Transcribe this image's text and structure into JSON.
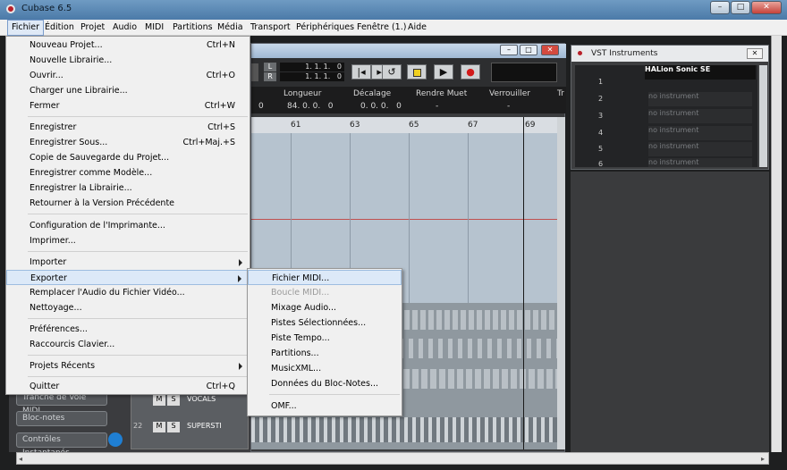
{
  "window": {
    "title": "Cubase 6.5",
    "minimize": "–",
    "maximize": "□",
    "close": "✕"
  },
  "menubar": [
    "Fichier",
    "Édition",
    "Projet",
    "Audio",
    "MIDI",
    "Partitions",
    "Média",
    "Transport",
    "Périphériques",
    "Fenêtre (1.)",
    "Aide"
  ],
  "fichier_menu": [
    {
      "label": "Nouveau Projet...",
      "shortcut": "Ctrl+N"
    },
    {
      "label": "Nouvelle Librairie...",
      "shortcut": ""
    },
    {
      "label": "Ouvrir...",
      "shortcut": "Ctrl+O"
    },
    {
      "label": "Charger une Librairie...",
      "shortcut": ""
    },
    {
      "label": "Fermer",
      "shortcut": "Ctrl+W"
    },
    {
      "label": "Enregistrer",
      "shortcut": "Ctrl+S"
    },
    {
      "label": "Enregistrer Sous...",
      "shortcut": "Ctrl+Maj.+S"
    },
    {
      "label": "Copie de Sauvegarde du Projet...",
      "shortcut": ""
    },
    {
      "label": "Enregistrer comme Modèle...",
      "shortcut": ""
    },
    {
      "label": "Enregistrer la Librairie...",
      "shortcut": ""
    },
    {
      "label": "Retourner à la Version Précédente",
      "shortcut": ""
    },
    {
      "label": "Configuration de l'Imprimante...",
      "shortcut": ""
    },
    {
      "label": "Imprimer...",
      "shortcut": ""
    },
    {
      "label": "Importer",
      "shortcut": ""
    },
    {
      "label": "Exporter",
      "shortcut": ""
    },
    {
      "label": "Remplacer l'Audio du Fichier Vidéo...",
      "shortcut": ""
    },
    {
      "label": "Nettoyage...",
      "shortcut": ""
    },
    {
      "label": "Préférences...",
      "shortcut": ""
    },
    {
      "label": "Raccourcis Clavier...",
      "shortcut": ""
    },
    {
      "label": "Projets Récents",
      "shortcut": ""
    },
    {
      "label": "Quitter",
      "shortcut": "Ctrl+Q"
    }
  ],
  "exporter_menu": [
    "Fichier MIDI...",
    "Boucle MIDI...",
    "Mixage Audio...",
    "Pistes Sélectionnées...",
    "Piste Tempo...",
    "Partitions...",
    "MusicXML...",
    "Données du Bloc-Notes...",
    "OMF..."
  ],
  "project": {
    "title": "",
    "locators": {
      "left": "1. 1. 1.   0",
      "right": "1. 1. 1.   0",
      "l": "L",
      "r": "R"
    },
    "info_headers": [
      "Longueur",
      "Décalage",
      "Rendre Muet",
      "Verrouiller",
      "Tr"
    ],
    "info_values": [
      "0",
      "84. 0. 0.   0",
      "0. 0. 0.   0",
      "-",
      "-"
    ],
    "ruler_marks": [
      "61",
      "63",
      "65",
      "67",
      "69"
    ],
    "tracks": [
      {
        "m": "M",
        "s": "S",
        "name": "VOCALS"
      },
      {
        "m": "M",
        "s": "S",
        "name": "SUPERSTI"
      }
    ],
    "track_number": "22"
  },
  "transport_icons": [
    "go-to-previous-marker-icon",
    "go-to-next-marker-icon",
    "cycle-icon",
    "stop-icon",
    "play-icon",
    "record-icon"
  ],
  "vst": {
    "title": "VST Instruments",
    "slots": [
      {
        "num": "1",
        "name": "HALion Sonic SE"
      },
      {
        "num": "2",
        "name": "no instrument"
      },
      {
        "num": "3",
        "name": "no instrument"
      },
      {
        "num": "4",
        "name": "no instrument"
      },
      {
        "num": "5",
        "name": "no instrument"
      },
      {
        "num": "6",
        "name": "no instrument"
      }
    ]
  },
  "left_panel": [
    "Tranche de Voie MIDI",
    "Bloc-notes",
    "Contrôles Instantanés"
  ],
  "colors": {
    "titlebar": "#5b88b4",
    "menu_bg": "#f0f0f0",
    "highlight": "#dce9f8",
    "record": "#d21a1a",
    "stop": "#f0d020",
    "grid": "#b6c3cf"
  }
}
